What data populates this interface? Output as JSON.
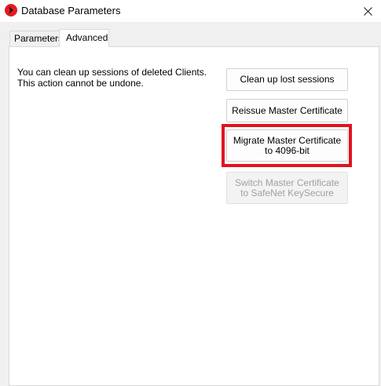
{
  "window": {
    "title": "Database Parameters",
    "icon": "app-logo-icon",
    "close_icon": "close-icon"
  },
  "tabs": [
    {
      "label": "Parameters",
      "selected": false
    },
    {
      "label": "Advanced",
      "selected": true
    }
  ],
  "advanced": {
    "description": "You can clean up sessions of deleted Clients. This action cannot be undone.",
    "buttons": {
      "cleanup": "Clean up lost sessions",
      "reissue": "Reissue Master Certificate",
      "migrate": "Migrate Master Certificate to 4096-bit",
      "switch": "Switch Master Certificate to SafeNet KeySecure"
    },
    "switch_enabled": false
  },
  "colors": {
    "highlight": "#e0141e",
    "logo": "#e31b23"
  }
}
